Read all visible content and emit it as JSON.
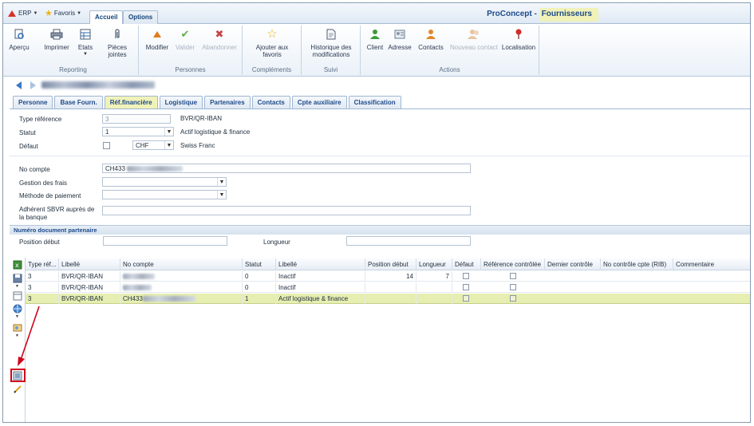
{
  "topbar": {
    "erp_label": "ERP",
    "favoris_label": "Favoris",
    "tab_accueil": "Accueil",
    "tab_options": "Options",
    "app_title_prefix": "ProConcept - ",
    "app_title_highlight": "Fournisseurs"
  },
  "ribbon": {
    "reporting": {
      "label": "Reporting",
      "apercu": "Aperçu",
      "imprimer": "Imprimer",
      "etats": "Etats",
      "pieces_jointes_1": "Pièces",
      "pieces_jointes_2": "jointes"
    },
    "personnes": {
      "label": "Personnes",
      "modifier": "Modifier",
      "valider": "Valider",
      "abandonner": "Abandonner"
    },
    "complements": {
      "label": "Compléments",
      "ajouter_1": "Ajouter aux",
      "ajouter_2": "favoris"
    },
    "suivi": {
      "label": "Suivi",
      "historique_1": "Historique des",
      "historique_2": "modifications"
    },
    "actions": {
      "label": "Actions",
      "client": "Client",
      "adresse": "Adresse",
      "contacts": "Contacts",
      "nouveau_contact": "Nouveau contact",
      "localisation": "Localisation"
    }
  },
  "tabs": [
    "Personne",
    "Base Fourn.",
    "Réf.financière",
    "Logistique",
    "Partenaires",
    "Contacts",
    "Cpte auxiliaire",
    "Classification"
  ],
  "form": {
    "type_reference_label": "Type référence",
    "type_reference_value": "3",
    "type_reference_desc": "BVR/QR-IBAN",
    "statut_label": "Statut",
    "statut_value": "1",
    "statut_desc": "Actif logistique & finance",
    "defaut_label": "Défaut",
    "currency_value": "CHF",
    "currency_desc": "Swiss Franc",
    "no_compte_label": "No compte",
    "no_compte_value": "CH433",
    "gestion_frais_label": "Gestion des frais",
    "methode_paiement_label": "Méthode de paiement",
    "adherent_label_1": "Adhérent SBVR auprès de",
    "adherent_label_2": "la banque",
    "section_title": "Numéro document partenaire",
    "position_debut_label": "Position début",
    "longueur_label": "Longueur"
  },
  "grid": {
    "headers": [
      "Type réf...",
      "Libellé",
      "No compte",
      "Statut",
      "Libellé",
      "Position début",
      "Longueur",
      "Défaut",
      "Référence contrôlée",
      "Dernier contrôle",
      "No contrôle cpte (RIB)",
      "Commentaire"
    ],
    "rows": [
      {
        "type": "3",
        "libelle": "BVR/QR-IBAN",
        "no_compte": "",
        "statut": "0",
        "libelle2": "Inactif",
        "position": "14",
        "longueur": "7"
      },
      {
        "type": "3",
        "libelle": "BVR/QR-IBAN",
        "no_compte": "",
        "statut": "0",
        "libelle2": "Inactif",
        "position": "",
        "longueur": ""
      },
      {
        "type": "3",
        "libelle": "BVR/QR-IBAN",
        "no_compte": "CH433",
        "statut": "1",
        "libelle2": "Actif logistique & finance",
        "position": "",
        "longueur": ""
      }
    ]
  },
  "colors": {
    "accent": "#1d4a8a",
    "highlight": "#f0f2b8",
    "selected_row": "#e6eeb1",
    "annotation": "#d0021b"
  }
}
